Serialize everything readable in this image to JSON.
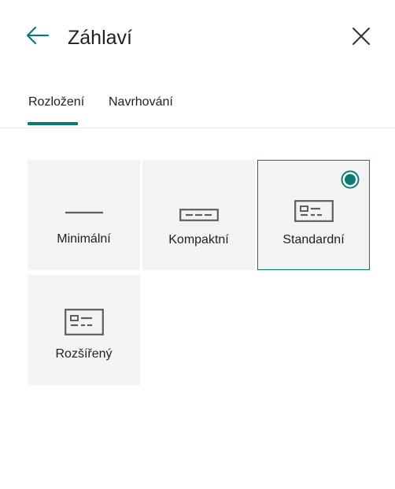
{
  "header": {
    "title": "Záhlaví"
  },
  "tabs": [
    {
      "label": "Rozložení",
      "active": true
    },
    {
      "label": "Navrhování",
      "active": false
    }
  ],
  "layouts": [
    {
      "label": "Minimální",
      "icon": "minimal-layout-icon",
      "selected": false
    },
    {
      "label": "Kompaktní",
      "icon": "compact-layout-icon",
      "selected": false
    },
    {
      "label": "Standardní",
      "icon": "standard-layout-icon",
      "selected": true
    },
    {
      "label": "Rozšířený",
      "icon": "extended-layout-icon",
      "selected": false
    }
  ],
  "colors": {
    "accent": "#0b7a75",
    "tile_bg": "#f3f3f3",
    "text": "#201f1e",
    "icon": "#605e5c"
  }
}
